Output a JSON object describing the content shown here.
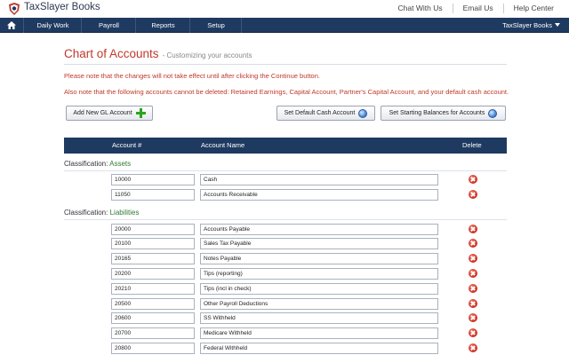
{
  "header": {
    "brand": "TaxSlayer Books",
    "links": [
      "Chat With Us",
      "Email Us",
      "Help Center"
    ]
  },
  "nav": {
    "items": [
      "Daily Work",
      "Payroll",
      "Reports",
      "Setup"
    ],
    "right_menu": "TaxSlayer Books"
  },
  "page": {
    "title": "Chart of Accounts",
    "subtitle": "- Customizing your accounts",
    "note1": "Please note that the changes will not take effect until after clicking the Continue button.",
    "note2": "Also note that the following accounts cannot be deleted: Retained Earnings, Capital Account, Partner's Capital Account, and your default cash account."
  },
  "buttons": {
    "add_gl": "Add New GL Account",
    "set_default_cash": "Set Default Cash Account",
    "set_starting_balances": "Set Starting Balances for Accounts"
  },
  "table": {
    "col_account": "Account #",
    "col_name": "Account Name",
    "col_delete": "Delete",
    "classification_prefix": "Classification:",
    "groups": [
      {
        "name": "Assets",
        "rows": [
          {
            "number": "10000",
            "name": "Cash"
          },
          {
            "number": "11050",
            "name": "Accounts Receivable"
          }
        ]
      },
      {
        "name": "Liabilities",
        "rows": [
          {
            "number": "20000",
            "name": "Accounts Payable"
          },
          {
            "number": "20100",
            "name": "Sales Tax Payable"
          },
          {
            "number": "20165",
            "name": "Notes Payable"
          },
          {
            "number": "20200",
            "name": "Tips (reporting)"
          },
          {
            "number": "20210",
            "name": "Tips (incl in check)"
          },
          {
            "number": "20500",
            "name": "Other Payroll Deductions"
          },
          {
            "number": "20600",
            "name": "SS Withheld"
          },
          {
            "number": "20700",
            "name": "Medicare Withheld"
          },
          {
            "number": "20800",
            "name": "Federal Withheld"
          }
        ]
      }
    ]
  },
  "colors": {
    "navy": "#1f3a61",
    "title_red": "#c0392b",
    "classification_green": "#2e7d32"
  }
}
